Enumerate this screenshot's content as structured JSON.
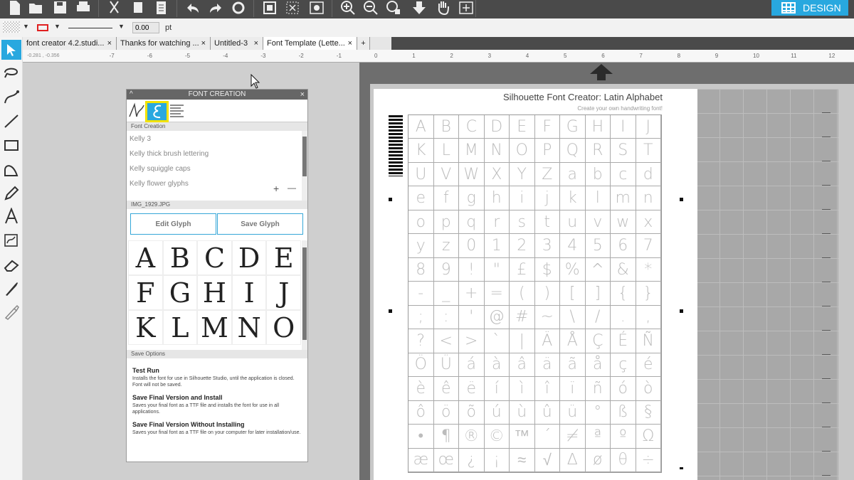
{
  "toolbar": {
    "design_label": "DESIGN",
    "icons": [
      "new-doc-icon",
      "open-folder-icon",
      "save-icon",
      "print-icon",
      "cut-icon",
      "copy-icon",
      "paste-icon",
      "undo-icon",
      "redo-icon",
      "refresh-icon",
      "group-icon",
      "ungroup-icon",
      "replicate-icon",
      "zoom-in-icon",
      "zoom-out-icon",
      "zoom-fit-icon",
      "move-down-icon",
      "pan-hand-icon",
      "add-page-icon"
    ]
  },
  "properties": {
    "line_width_value": "0.00",
    "line_width_unit": "pt"
  },
  "tabs": [
    {
      "label": "font creator 4.2.studi..."
    },
    {
      "label": "Thanks for watching ..."
    },
    {
      "label": "Untitled-3"
    },
    {
      "label": "Font Template (Lette..."
    }
  ],
  "new_tab_label": "+",
  "ruler": {
    "left_readout": "-0.281 , -0.356",
    "ticks": [
      "-7",
      "-6",
      "-5",
      "-4",
      "-3",
      "-2",
      "-1",
      "0",
      "1",
      "2",
      "3",
      "4",
      "5",
      "6",
      "7",
      "8",
      "9",
      "10",
      "11",
      "12"
    ]
  },
  "panel": {
    "title": "FONT CREATION",
    "section_font_creation": "Font Creation",
    "fonts": [
      "Kelly 3",
      "Kelly thick brush lettering",
      "Kelly squiggle caps",
      "Kelly flower glyphs"
    ],
    "add_label": "+",
    "remove_label": "—",
    "image_file": "IMG_1929.JPG",
    "edit_glyph": "Edit Glyph",
    "save_glyph": "Save Glyph",
    "glyphs": [
      "A",
      "B",
      "C",
      "D",
      "E",
      "F",
      "G",
      "H",
      "I",
      "J",
      "K",
      "L",
      "M",
      "N",
      "O"
    ],
    "save_options_label": "Save Options",
    "options": [
      {
        "title": "Test Run",
        "desc": "Installs the font for use in Silhouette Studio, until the application is closed. Font will not be saved."
      },
      {
        "title": "Save Final Version and Install",
        "desc": "Saves your final font as a TTF file and installs the font for use in all applications."
      },
      {
        "title": "Save Final Version Without Installing",
        "desc": "Saves your final font as a TTF file on your computer for later installation/use."
      }
    ]
  },
  "template": {
    "title": "Silhouette Font Creator: Latin Alphabet",
    "subtitle": "Create your own handwriting font!",
    "glyphs": [
      "A",
      "B",
      "C",
      "D",
      "E",
      "F",
      "G",
      "H",
      "I",
      "J",
      "K",
      "L",
      "M",
      "N",
      "O",
      "P",
      "Q",
      "R",
      "S",
      "T",
      "U",
      "V",
      "W",
      "X",
      "Y",
      "Z",
      "a",
      "b",
      "c",
      "d",
      "e",
      "f",
      "g",
      "h",
      "i",
      "j",
      "k",
      "l",
      "m",
      "n",
      "o",
      "p",
      "q",
      "r",
      "s",
      "t",
      "u",
      "v",
      "w",
      "x",
      "y",
      "z",
      "0",
      "1",
      "2",
      "3",
      "4",
      "5",
      "6",
      "7",
      "8",
      "9",
      "!",
      "\"",
      "£",
      "$",
      "%",
      "^",
      "&",
      "*",
      "-",
      "_",
      "+",
      "=",
      "(",
      ")",
      "[",
      "]",
      "{",
      "}",
      ";",
      ":",
      "'",
      "@",
      "#",
      "~",
      "\\",
      "/",
      ".",
      ",",
      "?",
      "<",
      ">",
      "`",
      "|",
      "Ä",
      "Å",
      "Ç",
      "É",
      "Ñ",
      "Ö",
      "Ü",
      "á",
      "à",
      "â",
      "ä",
      "ã",
      "å",
      "ç",
      "é",
      "è",
      "ê",
      "ë",
      "í",
      "ì",
      "î",
      "ï",
      "ñ",
      "ó",
      "ò",
      "ô",
      "ö",
      "õ",
      "ú",
      "ù",
      "û",
      "ü",
      "°",
      "ß",
      "§",
      "•",
      "¶",
      "®",
      "©",
      "™",
      "´",
      "≠",
      "ª",
      "º",
      "Ω",
      "æ",
      "œ",
      "¿",
      "¡",
      "≈",
      "√",
      "∆",
      "ø",
      "θ",
      "÷"
    ]
  },
  "colors": {
    "accent": "#28a8df",
    "panel_highlight": "#f2e200"
  }
}
